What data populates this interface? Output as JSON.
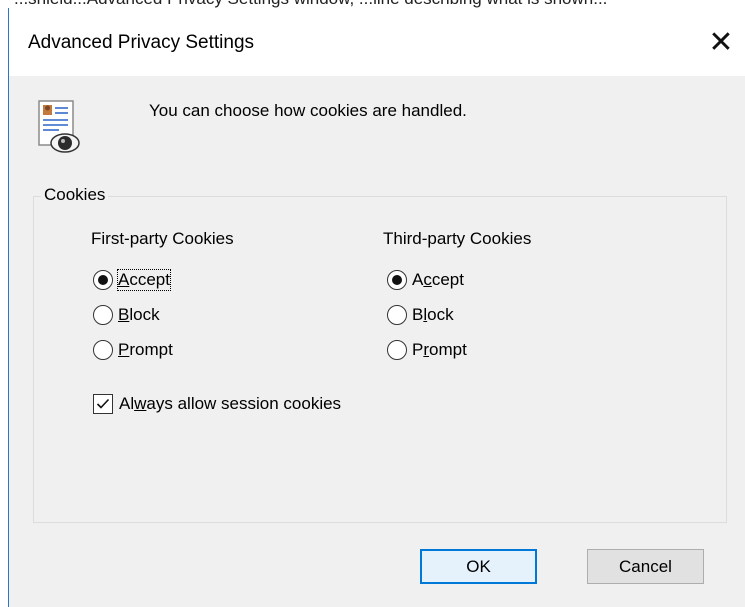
{
  "background_partial_text": "...shield...Advanced Privacy Settings window, ...line describing what is shown...",
  "dialog": {
    "title": "Advanced Privacy Settings",
    "close_glyph": "✕",
    "intro_text": "You can choose how cookies are handled.",
    "icon": "document-eye-icon"
  },
  "cookies_group": {
    "legend": "Cookies",
    "first_party": {
      "title": "First-party Cookies",
      "options": [
        {
          "label": "Accept",
          "mnemonic_index": 0,
          "selected": true,
          "focused": true
        },
        {
          "label": "Block",
          "mnemonic_index": 0,
          "selected": false
        },
        {
          "label": "Prompt",
          "mnemonic_index": 0,
          "selected": false
        }
      ]
    },
    "third_party": {
      "title": "Third-party Cookies",
      "options": [
        {
          "label": "Accept",
          "mnemonic_index": 1,
          "selected": true
        },
        {
          "label": "Block",
          "mnemonic_index": 1,
          "selected": false
        },
        {
          "label": "Prompt",
          "mnemonic_index": 1,
          "selected": false
        }
      ]
    },
    "session_checkbox": {
      "label": "Always allow session cookies",
      "mnemonic_index": 1,
      "checked": true
    }
  },
  "buttons": {
    "ok": "OK",
    "cancel": "Cancel"
  },
  "colors": {
    "accent": "#0078d7",
    "dialog_bg": "#f0f0f0",
    "window_border": "#2b74c8"
  }
}
